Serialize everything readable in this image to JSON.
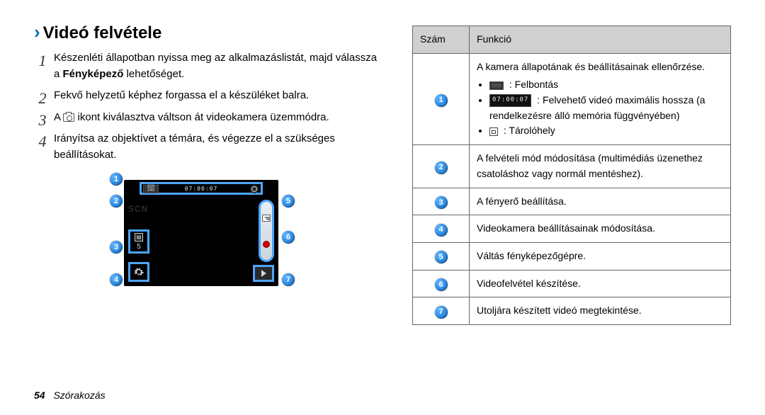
{
  "heading": {
    "chev": "›",
    "title": "Videó felvétele"
  },
  "steps": {
    "s1a": "Készenléti állapotban nyissa meg az alkalmazáslistát, majd válassza a ",
    "s1b": "Fényképező",
    "s1c": " lehetőséget.",
    "s2": "Fekvő helyzetű képhez forgassa el a készüléket balra.",
    "s3a": "A ",
    "s3b": " ikont kiválasztva váltson át videokamera üzemmódra.",
    "s4": "Irányítsa az objektívet a témára, és végezze el a szükséges beállításokat.",
    "n1": "1",
    "n2": "2",
    "n3": "3",
    "n4": "4"
  },
  "device_overlay": {
    "res_text": "320\n240",
    "time_text": "07:00:07",
    "bright_value": "5"
  },
  "callouts": {
    "c1": "1",
    "c2": "2",
    "c3": "3",
    "c4": "4",
    "c5": "5",
    "c6": "6",
    "c7": "7"
  },
  "table": {
    "h1": "Szám",
    "h2": "Funkció",
    "r1_line1": "A kamera állapotának és beállításainak ellenőrzése.",
    "r1_b1": " : Felbontás",
    "r1_b2_time": "07:00:07",
    "r1_b2_text": " : Felvehető videó maximális hossza (a rendelkezésre álló memória függvényében)",
    "r1_b3": " : Tárolóhely",
    "r2": "A felvételi mód módosítása (multimédiás üzenethez csatoláshoz vagy normál mentéshez).",
    "r3": "A fényerő beállítása.",
    "r4": "Videokamera beállításainak módosítása.",
    "r5": "Váltás fényképezőgépre.",
    "r6": "Videofelvétel készítése.",
    "r7": "Utoljára készített videó megtekintése."
  },
  "footer": {
    "page": "54",
    "section": "Szórakozás"
  }
}
